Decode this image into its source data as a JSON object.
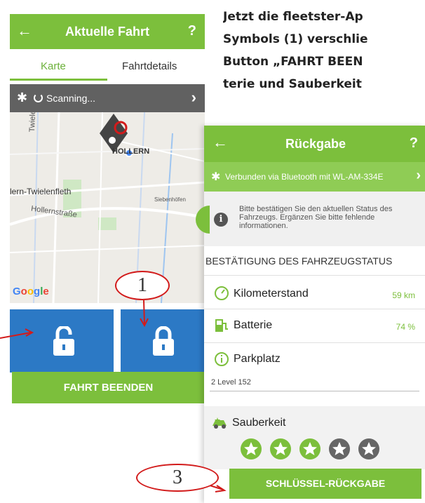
{
  "intro": {
    "line1": "Jetzt die fleetster-Ap",
    "line2": "Symbols (1) verschlie",
    "line3": "Button „FAHRT BEEN",
    "line4": "terie und Sauberkeit"
  },
  "screen1": {
    "header": {
      "back": "←",
      "title": "Aktuelle Fahrt",
      "help": "?"
    },
    "tabs": [
      {
        "label": "Karte",
        "active": true
      },
      {
        "label": "Fahrtdetails",
        "active": false
      }
    ],
    "bluetooth": {
      "status": "Scanning...",
      "chevron": "›"
    },
    "map": {
      "labels": {
        "road1": "Twielenflether Chau",
        "town": "lern-Twielenfleth",
        "street": "Hollernstraße",
        "side": "Siebenhöfen",
        "place": "HOLLERN"
      },
      "google": [
        "G",
        "o",
        "o",
        "g",
        "l",
        "e"
      ]
    },
    "end_trip_label": "FAHRT BEENDEN"
  },
  "screen2": {
    "header": {
      "back": "←",
      "title": "Rückgabe",
      "help": "?"
    },
    "bluetooth": {
      "text": "Verbunden via Bluetooth mit WL-AM-334E",
      "chevron": "›"
    },
    "info": {
      "icon": "i",
      "text": "Bitte bestätigen Sie den aktuellen Status des Fahrzeugs. Ergänzen Sie bitte fehlende informationen."
    },
    "section_title": "BESTÄTIGUNG DES FAHRZEUGSTATUS",
    "rows": {
      "km": {
        "label": "Kilometerstand",
        "value": "59 km"
      },
      "battery": {
        "label": "Batterie",
        "value": "74 %"
      },
      "parking": {
        "label": "Parkplatz",
        "value": "2 Level 152"
      }
    },
    "cleanliness": {
      "label": "Sauberkeit",
      "rating": 3,
      "max": 5
    },
    "key_return_label": "SCHLÜSSEL-RÜCKGABE"
  },
  "annotations": {
    "one": "1",
    "three": "3"
  },
  "colors": {
    "green": "#7cbf3c",
    "blue": "#2c79c5",
    "red": "#d21b1b",
    "grey": "#616161"
  }
}
